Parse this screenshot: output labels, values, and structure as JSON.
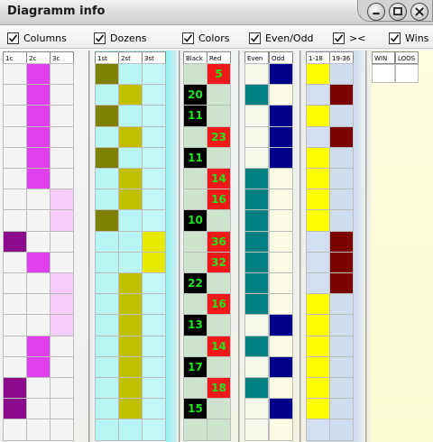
{
  "window": {
    "title": "Diagramm info"
  },
  "toolbar": {
    "options": [
      {
        "label": "Columns",
        "checked": true
      },
      {
        "label": "Dozens",
        "checked": true
      },
      {
        "label": "Colors",
        "checked": true
      },
      {
        "label": "Even/Odd",
        "checked": true
      },
      {
        "label": "><",
        "checked": true
      },
      {
        "label": "Wins",
        "checked": true
      }
    ]
  },
  "colors": {
    "empty_light": "#f2f2f2",
    "magenta": "#e040f0",
    "pink": "#f8ccf8",
    "purple": "#8c0a8c",
    "olive": "#808000",
    "yellow_olive": "#c0c000",
    "cyan": "#80ffff",
    "yellow": "#e8e800",
    "red": "#f01818",
    "black": "#000000",
    "teal": "#008080",
    "navy": "#00008a",
    "pale_yellow": "#ffff00",
    "maroon": "#7a0000",
    "number_green": "#1ee51e"
  },
  "columns_group": {
    "headers": [
      "1c",
      "2c",
      "3c"
    ],
    "rows": [
      [
        "",
        "magenta",
        ""
      ],
      [
        "",
        "magenta",
        ""
      ],
      [
        "",
        "magenta",
        ""
      ],
      [
        "",
        "magenta",
        ""
      ],
      [
        "",
        "magenta",
        ""
      ],
      [
        "",
        "magenta",
        ""
      ],
      [
        "",
        "",
        "pink"
      ],
      [
        "",
        "",
        "pink"
      ],
      [
        "purple",
        "",
        ""
      ],
      [
        "",
        "magenta",
        ""
      ],
      [
        "",
        "",
        "pink"
      ],
      [
        "",
        "",
        "pink"
      ],
      [
        "",
        "",
        "pink"
      ],
      [
        "",
        "magenta",
        ""
      ],
      [
        "",
        "magenta",
        ""
      ],
      [
        "purple",
        "",
        ""
      ],
      [
        "purple",
        "",
        ""
      ],
      [
        "",
        "",
        ""
      ]
    ]
  },
  "dozens_group": {
    "headers": [
      "1st",
      "2st",
      "3st"
    ],
    "rows": [
      [
        "olive",
        "",
        ""
      ],
      [
        "",
        "yellow_olive",
        ""
      ],
      [
        "olive",
        "",
        ""
      ],
      [
        "",
        "yellow_olive",
        ""
      ],
      [
        "olive",
        "",
        ""
      ],
      [
        "",
        "yellow_olive",
        ""
      ],
      [
        "",
        "yellow_olive",
        ""
      ],
      [
        "olive",
        "",
        ""
      ],
      [
        "",
        "",
        "yellow"
      ],
      [
        "",
        "",
        "yellow"
      ],
      [
        "",
        "yellow_olive",
        ""
      ],
      [
        "",
        "yellow_olive",
        ""
      ],
      [
        "",
        "yellow_olive",
        ""
      ],
      [
        "",
        "yellow_olive",
        ""
      ],
      [
        "",
        "yellow_olive",
        ""
      ],
      [
        "",
        "yellow_olive",
        ""
      ],
      [
        "",
        "yellow_olive",
        ""
      ],
      [
        "",
        "",
        ""
      ]
    ]
  },
  "colors_group": {
    "headers": [
      "Black",
      "Red"
    ],
    "rows": [
      {
        "black": "",
        "red": "5"
      },
      {
        "black": "20",
        "red": ""
      },
      {
        "black": "11",
        "red": ""
      },
      {
        "black": "",
        "red": "23"
      },
      {
        "black": "11",
        "red": ""
      },
      {
        "black": "",
        "red": "14"
      },
      {
        "black": "",
        "red": "16"
      },
      {
        "black": "10",
        "red": ""
      },
      {
        "black": "",
        "red": "36"
      },
      {
        "black": "",
        "red": "32"
      },
      {
        "black": "22",
        "red": ""
      },
      {
        "black": "",
        "red": "16"
      },
      {
        "black": "13",
        "red": ""
      },
      {
        "black": "",
        "red": "14"
      },
      {
        "black": "17",
        "red": ""
      },
      {
        "black": "",
        "red": "18"
      },
      {
        "black": "15",
        "red": ""
      },
      {
        "black": "",
        "red": ""
      }
    ]
  },
  "evenodd_group": {
    "headers": [
      "Even",
      "Odd"
    ],
    "rows": [
      [
        "",
        "navy"
      ],
      [
        "teal",
        ""
      ],
      [
        "",
        "navy"
      ],
      [
        "",
        "navy"
      ],
      [
        "",
        "navy"
      ],
      [
        "teal",
        ""
      ],
      [
        "teal",
        ""
      ],
      [
        "teal",
        ""
      ],
      [
        "teal",
        ""
      ],
      [
        "teal",
        ""
      ],
      [
        "teal",
        ""
      ],
      [
        "teal",
        ""
      ],
      [
        "",
        "navy"
      ],
      [
        "teal",
        ""
      ],
      [
        "",
        "navy"
      ],
      [
        "teal",
        ""
      ],
      [
        "",
        "navy"
      ],
      [
        "",
        ""
      ]
    ]
  },
  "range_group": {
    "headers": [
      "1-18",
      "19-36"
    ],
    "rows": [
      [
        "pale_yellow",
        ""
      ],
      [
        "",
        "maroon"
      ],
      [
        "pale_yellow",
        ""
      ],
      [
        "",
        "maroon"
      ],
      [
        "pale_yellow",
        ""
      ],
      [
        "pale_yellow",
        ""
      ],
      [
        "pale_yellow",
        ""
      ],
      [
        "pale_yellow",
        ""
      ],
      [
        "",
        "maroon"
      ],
      [
        "",
        "maroon"
      ],
      [
        "",
        "maroon"
      ],
      [
        "pale_yellow",
        ""
      ],
      [
        "pale_yellow",
        ""
      ],
      [
        "pale_yellow",
        ""
      ],
      [
        "pale_yellow",
        ""
      ],
      [
        "pale_yellow",
        ""
      ],
      [
        "pale_yellow",
        ""
      ],
      [
        "",
        ""
      ]
    ]
  },
  "wins_group": {
    "headers": [
      "WIN",
      "LOOS"
    ]
  }
}
